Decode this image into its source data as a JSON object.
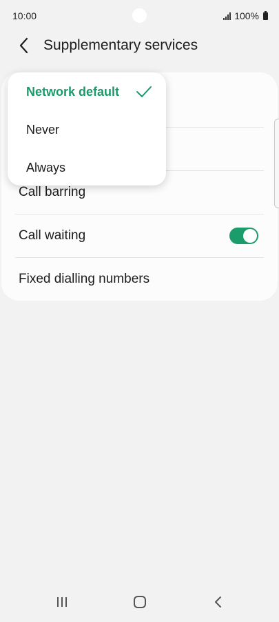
{
  "status": {
    "time": "10:00",
    "battery": "100%"
  },
  "header": {
    "title": "Supplementary services"
  },
  "list": {
    "items": [
      {
        "label": "Call barring"
      },
      {
        "label": "Call waiting",
        "toggle_on": true
      },
      {
        "label": "Fixed dialling numbers"
      }
    ]
  },
  "popup": {
    "options": [
      {
        "label": "Network default",
        "selected": true
      },
      {
        "label": "Never"
      },
      {
        "label": "Always"
      }
    ]
  },
  "colors": {
    "accent": "#1c9c6a",
    "background": "#f2f2f2",
    "card": "#fcfcfc"
  },
  "nav": {
    "icons": [
      "recent-apps-icon",
      "home-icon",
      "back-icon"
    ]
  }
}
